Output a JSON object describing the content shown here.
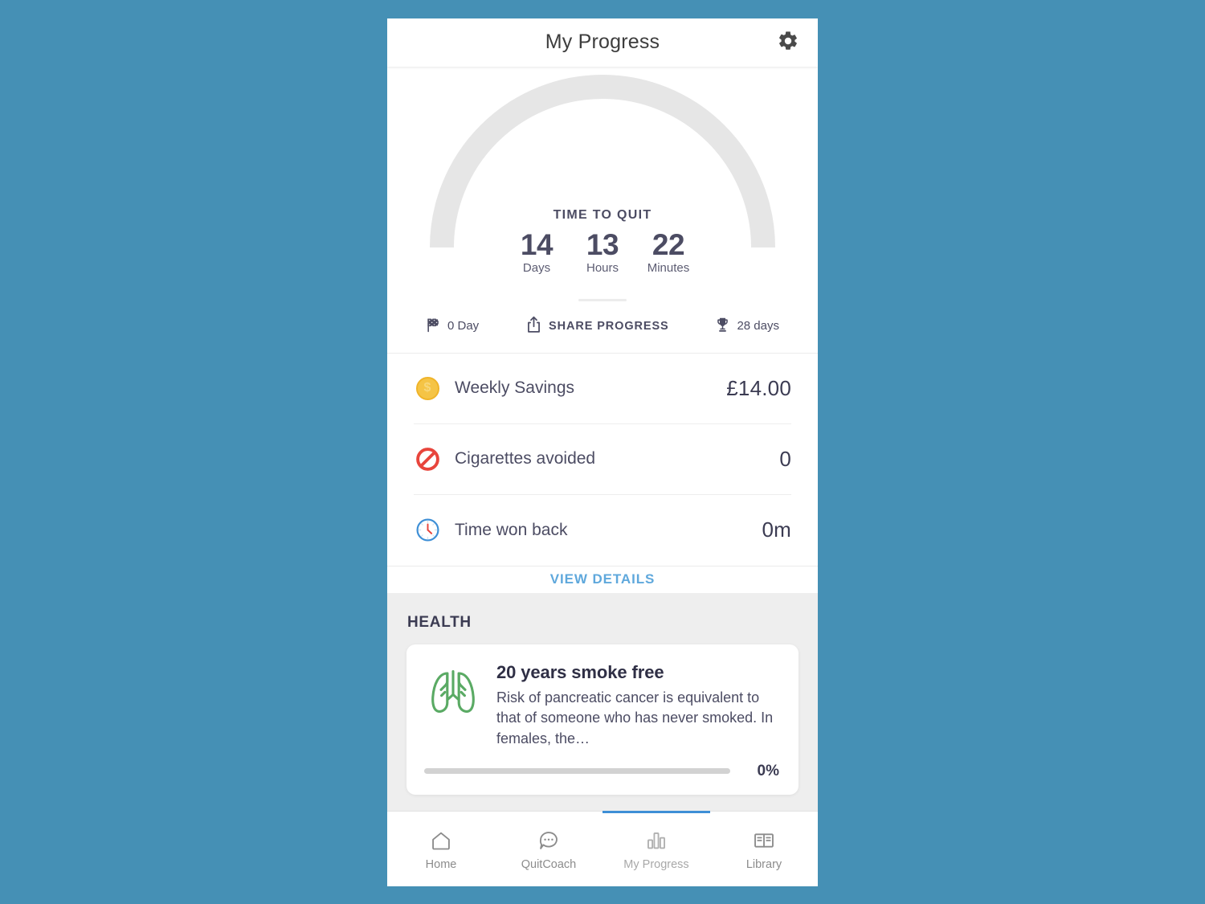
{
  "theme": {
    "page_background": "#4590b5",
    "accent_blue": "#5fa8dc",
    "text_dark": "#4c4c63",
    "nav_active_indicator": "#3e8fd6",
    "arc_track": "#e6e6e6"
  },
  "header": {
    "title": "My Progress",
    "settings_icon": "gear-icon"
  },
  "timer": {
    "caption": "TIME TO QUIT",
    "units": [
      {
        "value": "14",
        "label": "Days"
      },
      {
        "value": "13",
        "label": "Hours"
      },
      {
        "value": "22",
        "label": "Minutes"
      }
    ]
  },
  "actions": [
    {
      "icon": "checkered-flag-icon",
      "label": "0 Day",
      "style": "normal"
    },
    {
      "icon": "share-icon",
      "label": "SHARE PROGRESS",
      "style": "caps"
    },
    {
      "icon": "trophy-icon",
      "label": "28 days",
      "style": "normal"
    }
  ],
  "stats": [
    {
      "icon": "coin-icon",
      "label": "Weekly Savings",
      "value": "£14.00"
    },
    {
      "icon": "no-smoking-icon",
      "label": "Cigarettes avoided",
      "value": "0"
    },
    {
      "icon": "clock-icon",
      "label": "Time won back",
      "value": "0m"
    }
  ],
  "view_details": {
    "label": "VIEW DETAILS"
  },
  "health": {
    "section_title": "HEALTH",
    "card": {
      "icon": "lungs-icon",
      "heading": "20 years smoke free",
      "description": "Risk of pancreatic cancer is equivalent to that of someone who has never smoked. In females, the…",
      "progress_percent": "0%",
      "progress_value": 0
    }
  },
  "bottom_nav": {
    "items": [
      {
        "icon": "home-icon",
        "label": "Home",
        "active": false
      },
      {
        "icon": "chat-bubble-icon",
        "label": "QuitCoach",
        "active": false
      },
      {
        "icon": "bar-chart-icon",
        "label": "My Progress",
        "active": true
      },
      {
        "icon": "book-icon",
        "label": "Library",
        "active": false
      }
    ]
  }
}
